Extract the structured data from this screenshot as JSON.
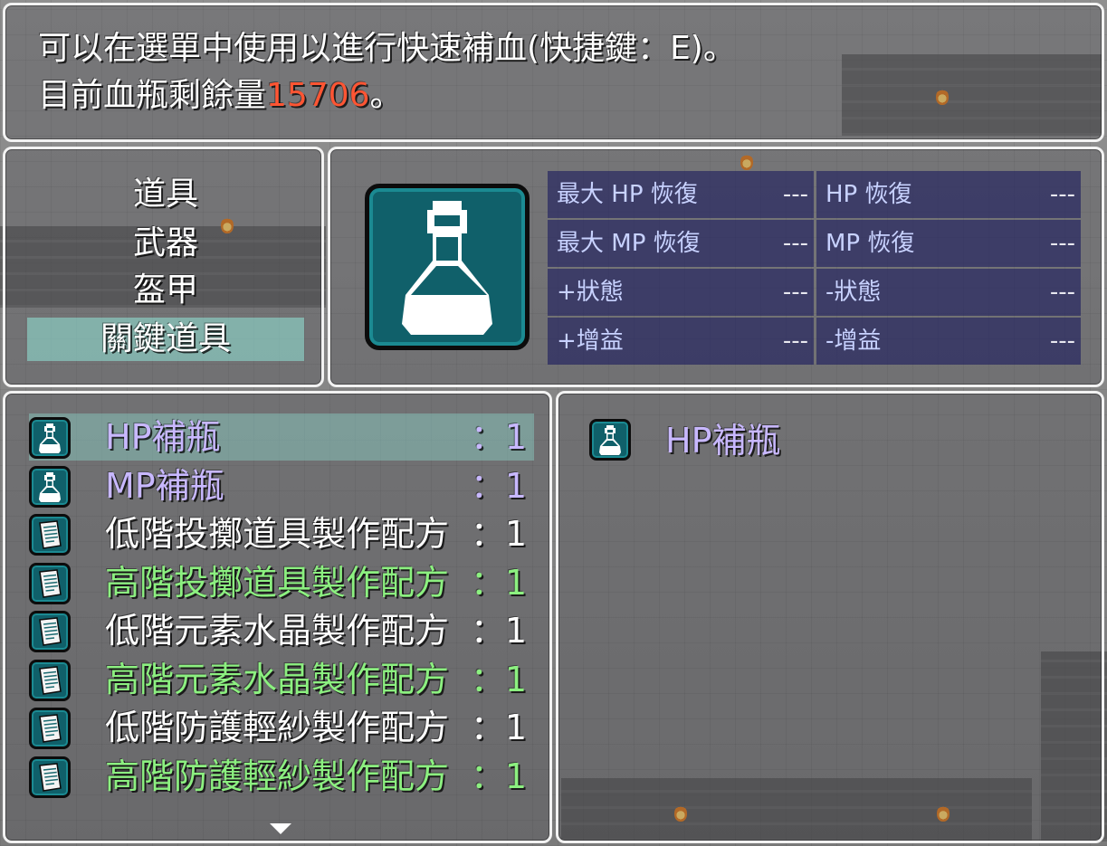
{
  "help": {
    "line1": "可以在選單中使用以進行快速補血(快捷鍵：E)。",
    "line2_prefix": "目前血瓶剩餘量",
    "line2_value": "15706",
    "line2_suffix": "。"
  },
  "categories": [
    {
      "label": "道具",
      "selected": false
    },
    {
      "label": "武器",
      "selected": false
    },
    {
      "label": "盔甲",
      "selected": false
    },
    {
      "label": "關鍵道具",
      "selected": true
    }
  ],
  "status": {
    "icon": "potion-icon",
    "params": [
      {
        "label": "最大 HP 恢復",
        "value": "---"
      },
      {
        "label": "HP 恢復",
        "value": "---"
      },
      {
        "label": "最大 MP 恢復",
        "value": "---"
      },
      {
        "label": "MP 恢復",
        "value": "---"
      },
      {
        "label": "+狀態",
        "value": "---"
      },
      {
        "label": "-狀態",
        "value": "---"
      },
      {
        "label": "+增益",
        "value": "---"
      },
      {
        "label": "-增益",
        "value": "---"
      }
    ]
  },
  "items": [
    {
      "name": "HP補瓶",
      "count": "：1",
      "icon": "potion-icon",
      "color": "#c8b8ff",
      "selected": true
    },
    {
      "name": "MP補瓶",
      "count": "：1",
      "icon": "potion-icon",
      "color": "#c8b8ff",
      "selected": false
    },
    {
      "name": "低階投擲道具製作配方",
      "count": "：1",
      "icon": "scroll-icon",
      "color": "#ffffff",
      "selected": false
    },
    {
      "name": "高階投擲道具製作配方",
      "count": "：1",
      "icon": "scroll-icon",
      "color": "#8cf080",
      "selected": false
    },
    {
      "name": "低階元素水晶製作配方",
      "count": "：1",
      "icon": "scroll-icon",
      "color": "#ffffff",
      "selected": false
    },
    {
      "name": "高階元素水晶製作配方",
      "count": "：1",
      "icon": "scroll-icon",
      "color": "#8cf080",
      "selected": false
    },
    {
      "name": "低階防護輕紗製作配方",
      "count": "：1",
      "icon": "scroll-icon",
      "color": "#ffffff",
      "selected": false
    },
    {
      "name": "高階防護輕紗製作配方",
      "count": "：1",
      "icon": "scroll-icon",
      "color": "#8cf080",
      "selected": false
    }
  ],
  "more_indicator": "chevron-down-icon",
  "detail": {
    "name": "HP補瓶",
    "icon": "potion-icon"
  },
  "colors": {
    "highlight": "#ff5533",
    "selection": "#8cd2c8",
    "param_label": "#c8d2ff"
  }
}
